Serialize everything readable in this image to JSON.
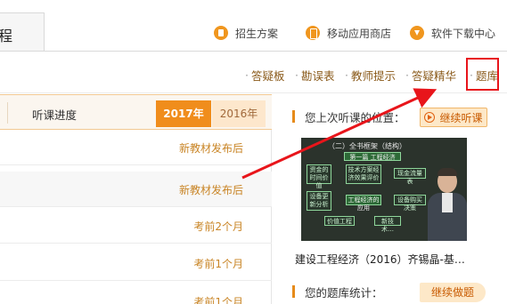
{
  "header": {
    "course_tab": "程",
    "links": [
      {
        "label": "招生方案",
        "icon": "document-icon"
      },
      {
        "label": "移动应用商店",
        "icon": "mobile-app-icon"
      },
      {
        "label": "软件下载中心",
        "icon": "download-icon"
      }
    ]
  },
  "subnav": {
    "items": [
      "答疑板",
      "勘误表",
      "教师提示",
      "答疑精华",
      "题库"
    ],
    "highlighted": "题库"
  },
  "table": {
    "column_header": "听课进度",
    "year_tabs": [
      {
        "label": "2017年",
        "active": true
      },
      {
        "label": "2016年",
        "active": false
      }
    ],
    "rows": [
      "",
      "新教材发布后",
      "新教材发布后",
      "考前2个月",
      "考前1个月",
      "考前1个月"
    ]
  },
  "last_lesson": {
    "title": "您上次听课的位置：",
    "resume_label": "继续听课",
    "course_name": "建设工程经济（2016）齐锡晶-基…",
    "video": {
      "heading": "（二）全书框架（结构）",
      "boxes": [
        "第一篇 工程经济",
        "资金的时间价值",
        "技术方案经济效果评价",
        "现金流量表",
        "设备更新分析",
        "工程经济的应用",
        "设备购买决策",
        "价值工程",
        "新技术…"
      ]
    }
  },
  "question_bank": {
    "title": "您的题库统计：",
    "button_label": "继续做题"
  },
  "colors": {
    "accent": "#f08d1c",
    "highlight": "#e8151b",
    "link": "#8a5a1a"
  }
}
